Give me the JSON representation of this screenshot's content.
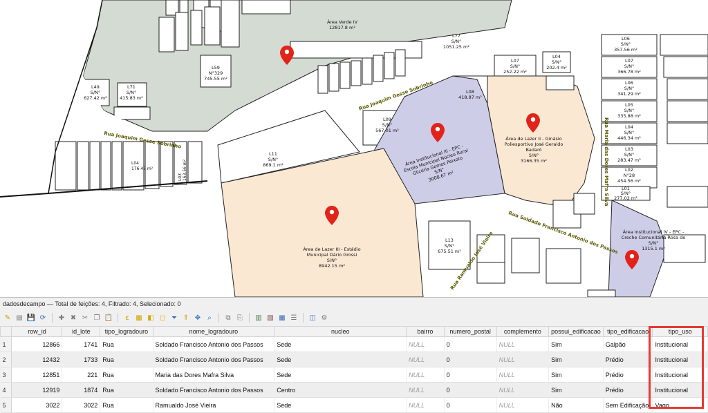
{
  "map": {
    "streets": [
      {
        "label": "Rua Joaquim Gesse Sobrinho"
      },
      {
        "label": "Rua Joaquim Gesse Sobrinho"
      },
      {
        "label": "Rua Maria das Dores Mafra Silva"
      },
      {
        "label": "Rua Soldado Francisco Antonio dos Passos"
      },
      {
        "label": "Rua Ramualdo José Vieira"
      }
    ],
    "areas": [
      {
        "lines": [
          "Área Verde IV",
          "12817.8 m²"
        ]
      },
      {
        "lines": [
          "Área Institucional III - EPC -",
          "Escola Municipal Núcleo Rural",
          "Glicéria Gomes Peixoto",
          "S/N°",
          "3008.67 m²"
        ]
      },
      {
        "lines": [
          "Área de Lazer II - Ginásio",
          "Poliesportivo José Geraldo",
          "Badaró",
          "S/N°",
          "3166.35 m²"
        ]
      },
      {
        "lines": [
          "Área de Lazer III - Estádio",
          "Municipal Dário Grossi",
          "S/N°",
          "8942.15 m²"
        ]
      },
      {
        "lines": [
          "Área Institucional IV - EPC -",
          "Creche Comunitária Rosa de",
          "S/N°",
          "1315.1 m²"
        ]
      }
    ],
    "lots": [
      {
        "lines": [
          "L59",
          "N°329",
          "745.55 m²"
        ]
      },
      {
        "lines": [
          "L77",
          "S/N°",
          "1051.25 m²"
        ]
      },
      {
        "lines": [
          "L11",
          "S/N°",
          "869.1 m²"
        ]
      },
      {
        "lines": [
          "L09",
          "S/N°",
          "567.01 m²"
        ]
      },
      {
        "lines": [
          "L08",
          "418.87 m²"
        ]
      },
      {
        "lines": [
          "L71",
          "S/N°",
          "415.83 m²"
        ]
      },
      {
        "lines": [
          "L49",
          "S/N°",
          "627.42 m²"
        ]
      },
      {
        "lines": [
          "L13",
          "S/N°",
          "675.51 m²"
        ]
      },
      {
        "lines": [
          "L06",
          "S/N°",
          "357.56 m²"
        ]
      },
      {
        "lines": [
          "L07",
          "S/N°",
          "252.22 m²"
        ]
      },
      {
        "lines": [
          "L04",
          "S/N°",
          "202.4 m²"
        ]
      },
      {
        "lines": [
          "L07",
          "S/N°",
          "366.78 m²"
        ]
      },
      {
        "lines": [
          "L06",
          "S/N°",
          "341.29 m²"
        ]
      },
      {
        "lines": [
          "L05",
          "S/N°",
          "335.88 m²"
        ]
      },
      {
        "lines": [
          "L04",
          "S/N°",
          "446.34 m²"
        ]
      },
      {
        "lines": [
          "L03",
          "S/N°",
          "283.47 m²"
        ]
      },
      {
        "lines": [
          "L02",
          "N°28",
          "454.56 m²"
        ]
      },
      {
        "lines": [
          "L01",
          "S/N°",
          "277.02 m²"
        ]
      },
      {
        "lines": [
          "L03",
          "163.56 m²"
        ]
      },
      {
        "lines": [
          "L04",
          "176.43 m²"
        ]
      }
    ]
  },
  "attribute_table": {
    "title": "dadosdecampo — Total de feições: 4, Filtrado: 4, Selecionado: 0",
    "toolbar_icons": [
      "pencil-icon",
      "multi-edit-icon",
      "save-icon",
      "reload-icon",
      "add-feature-icon",
      "delete-icon",
      "cut-icon",
      "copy-icon",
      "paste-icon",
      "expression-select-icon",
      "select-all-icon",
      "invert-selection-icon",
      "deselect-icon",
      "filter-icon",
      "move-selection-top-icon",
      "pan-to-selection-icon",
      "zoom-to-selection-icon",
      "copy-rows-icon",
      "paste-rows-icon",
      "new-field-icon",
      "delete-field-icon",
      "field-calculator-icon",
      "conditional-format-icon",
      "dock-icon",
      "actions-icon"
    ],
    "columns": [
      "",
      "row_id",
      "id_lote",
      "tipo_logradouro",
      "nome_logradouro",
      "nucleo",
      "bairro",
      "numero_postal",
      "complemento",
      "possui_edificacao",
      "tipo_edificacao",
      "tipo_uso"
    ],
    "rows": [
      [
        "1",
        "12866",
        "1741",
        "Rua",
        "Soldado Francisco Antonio dos Passos",
        "Sede",
        "NULL",
        "0",
        "NULL",
        "Sim",
        "Galpão",
        "Institucional"
      ],
      [
        "2",
        "12432",
        "1733",
        "Rua",
        "Soldado Francisco Antonio dos Passos",
        "Sede",
        "NULL",
        "0",
        "NULL",
        "Sim",
        "Prédio",
        "Institucional"
      ],
      [
        "3",
        "12851",
        "221",
        "Rua",
        "Maria das Dores Mafra Silva",
        "Sede",
        "NULL",
        "0",
        "NULL",
        "Sim",
        "Prédio",
        "Institucional"
      ],
      [
        "4",
        "12919",
        "1874",
        "Rua",
        "Soldado Francisco Antonio dos Passos",
        "Centro",
        "NULL",
        "0",
        "NULL",
        "Sim",
        "Prédio",
        "Institucional"
      ],
      [
        "5",
        "3022",
        "3022",
        "Rua",
        "Ramualdo José Vieira",
        "Sede",
        "NULL",
        "0",
        "NULL",
        "Não",
        "Sem Edificação",
        "Vago"
      ]
    ]
  },
  "colors": {
    "green_area": "#d3dbd3",
    "institutional": "#cdcde8",
    "leisure": "#fbe8d3",
    "marker": "#e2231a",
    "highlight": "#e53935"
  }
}
